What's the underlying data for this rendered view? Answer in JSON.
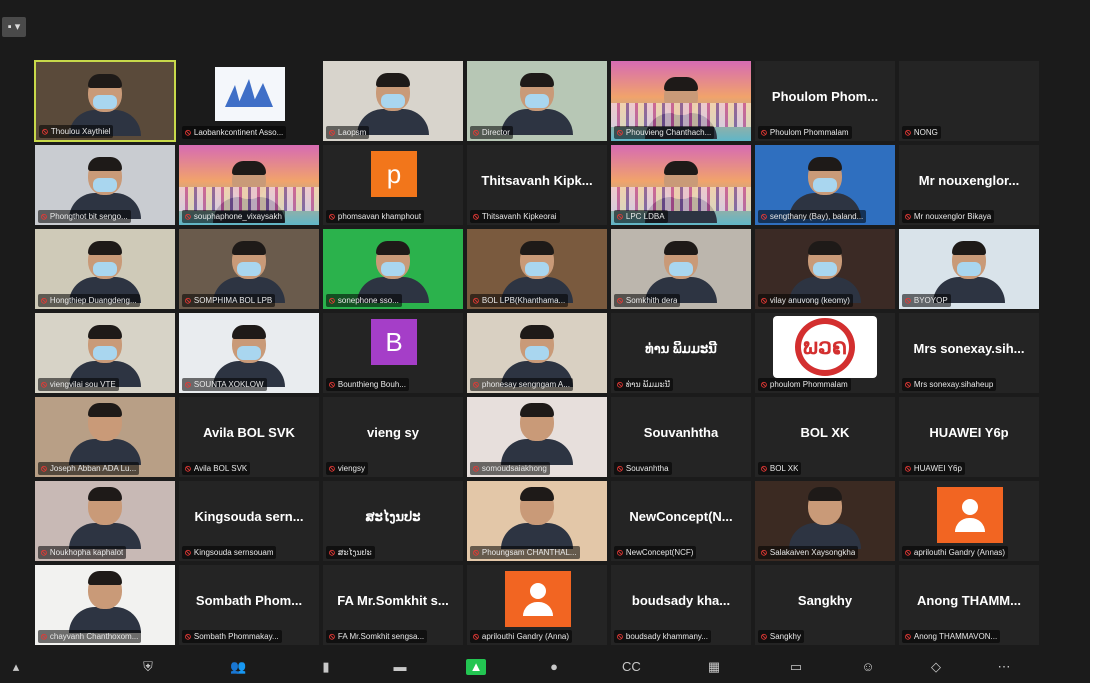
{
  "window": {
    "view_button": "▪ ▾"
  },
  "tiles": [
    {
      "kind": "video",
      "caption": "Thoulou Xaythiel",
      "bg": "#5a4a3a",
      "active": true
    },
    {
      "kind": "logo",
      "caption": "Laobankcontinent Asso...",
      "bg": "#f4f7fb"
    },
    {
      "kind": "video",
      "caption": "Laopsm",
      "bg": "#d8d4cc"
    },
    {
      "kind": "video",
      "caption": "Director",
      "bg": "#b7c7b5"
    },
    {
      "kind": "banner",
      "caption": "Phouvieng Chanthach..."
    },
    {
      "kind": "name",
      "name": "Phoulom Phom...",
      "caption": "Phoulom Phommalam"
    },
    {
      "kind": "blank",
      "caption": "NONG"
    },
    {
      "kind": "video",
      "caption": "Phongthot bit sengo...",
      "bg": "#c9ccd1"
    },
    {
      "kind": "banner",
      "caption": "souphaphone_vixaysakh"
    },
    {
      "kind": "letter",
      "letter": "p",
      "letter_bg": "#f2761b",
      "caption": "phomsavan khamphout"
    },
    {
      "kind": "name",
      "name": "Thitsavanh Kipk...",
      "caption": "Thitsavanh Kipkeorai"
    },
    {
      "kind": "banner",
      "caption": "LPC LDBA"
    },
    {
      "kind": "video",
      "caption": "sengthany (Bay), baland...",
      "bg": "#2f6fbf"
    },
    {
      "kind": "name",
      "name": "Mr nouxenglor...",
      "caption": "Mr nouxenglor Bikaya"
    },
    {
      "kind": "video",
      "caption": "Hongthiep Duangdeng...",
      "bg": "#cfcab8"
    },
    {
      "kind": "video",
      "caption": "SOMPHIMA BOL LPB",
      "bg": "#6a5b4c"
    },
    {
      "kind": "video",
      "caption": "sonephone sso...",
      "bg": "#2bb24c"
    },
    {
      "kind": "video",
      "caption": "BOL LPB(Khanthama...",
      "bg": "#7a5a3e"
    },
    {
      "kind": "video",
      "caption": "Somkhith dera",
      "bg": "#bcb6ad"
    },
    {
      "kind": "video",
      "caption": "vilay anuvong (keomy)",
      "bg": "#3b2a25"
    },
    {
      "kind": "video",
      "caption": "BYOYOP",
      "bg": "#d9e3ea"
    },
    {
      "kind": "video",
      "caption": "viengvilai sou VTE",
      "bg": "#d7d3c7"
    },
    {
      "kind": "video",
      "caption": "SOUNTA XOKLOW",
      "bg": "#e9ecef"
    },
    {
      "kind": "letter",
      "letter": "B",
      "letter_bg": "#a53ec8",
      "caption": "Bounthieng Bouh..."
    },
    {
      "kind": "video",
      "caption": "phonesay sengngam A...",
      "bg": "#d9d0c2"
    },
    {
      "kind": "name",
      "name": "ທ່ານ ພິມມະນີ",
      "caption": "ທ່ານ ພິມມະນີ"
    },
    {
      "kind": "redlogo",
      "logo_text": "ພວຄ",
      "caption": "phoulom Phommalam"
    },
    {
      "kind": "name",
      "name": "Mrs sonexay.sih...",
      "caption": "Mrs sonexay.sihaheup"
    },
    {
      "kind": "photo",
      "caption": "Joseph Abban ADA Lu...",
      "bg": "#b89f86"
    },
    {
      "kind": "name",
      "name": "Avila BOL SVK",
      "caption": "Avila BOL SVK"
    },
    {
      "kind": "name",
      "name": "vieng sy",
      "caption": "viengsy"
    },
    {
      "kind": "photo",
      "caption": "somoudsaiakhong",
      "bg": "#e7dfdc"
    },
    {
      "kind": "name",
      "name": "Souvanhtha",
      "caption": "Souvanhtha"
    },
    {
      "kind": "name",
      "name": "BOL XK",
      "caption": "BOL XK"
    },
    {
      "kind": "name",
      "name": "HUAWEI Y6p",
      "caption": "HUAWEI Y6p"
    },
    {
      "kind": "photo",
      "caption": "Noukhopha kaphalot",
      "bg": "#c8b9b5"
    },
    {
      "kind": "name",
      "name": "Kingsouda sern...",
      "caption": "Kingsouda sernsouam"
    },
    {
      "kind": "name",
      "name": "ສະໄງນປະ",
      "caption": "ສະໄງນປະ"
    },
    {
      "kind": "photo",
      "caption": "Phoungsam CHANTHAL...",
      "bg": "#e3c7a8"
    },
    {
      "kind": "name",
      "name": "NewConcept(N...",
      "caption": "NewConcept(NCF)"
    },
    {
      "kind": "photo",
      "caption": "Salakaiven Xaysongkha",
      "bg": "#3b2a22"
    },
    {
      "kind": "avatar",
      "caption": "aprilouthi Gandry (Annas)"
    },
    {
      "kind": "photo",
      "caption": "chayvanh Chanthoxom...",
      "bg": "#f2f2f0"
    },
    {
      "kind": "name",
      "name": "Sombath Phom...",
      "caption": "Sombath Phommakay..."
    },
    {
      "kind": "name",
      "name": "FA Mr.Somkhit s...",
      "caption": "FA Mr.Somkhit sengsa..."
    },
    {
      "kind": "avatar",
      "caption": "aprilouthi Gandry (Anna)"
    },
    {
      "kind": "name",
      "name": "boudsady kha...",
      "caption": "boudsady khammany..."
    },
    {
      "kind": "name",
      "name": "Sangkhy",
      "caption": "Sangkhy"
    },
    {
      "kind": "name",
      "name": "Anong THAMM...",
      "caption": "Anong THAMMAVON..."
    }
  ],
  "toolbar": [
    {
      "icon": "audio-icon",
      "glyph": "▴"
    },
    {
      "icon": "security-icon",
      "glyph": "⛨"
    },
    {
      "icon": "participants-icon",
      "glyph": "👥"
    },
    {
      "icon": "polls-icon",
      "glyph": "▮"
    },
    {
      "icon": "chat-icon",
      "glyph": "▬"
    },
    {
      "icon": "share-screen-icon",
      "glyph": "▲"
    },
    {
      "icon": "record-icon",
      "glyph": "●"
    },
    {
      "icon": "closed-caption-icon",
      "glyph": "CC"
    },
    {
      "icon": "breakout-rooms-icon",
      "glyph": "▦"
    },
    {
      "icon": "whiteboard-icon",
      "glyph": "▭"
    },
    {
      "icon": "reactions-icon",
      "glyph": "☺"
    },
    {
      "icon": "apps-icon",
      "glyph": "◇"
    },
    {
      "icon": "more-icon",
      "glyph": "⋯"
    }
  ],
  "colors": {
    "background": "#1b1b1b",
    "tile": "#242424",
    "mic_muted": "#e53935",
    "active_border": "#c8d94a",
    "video_on": "#23c552"
  }
}
